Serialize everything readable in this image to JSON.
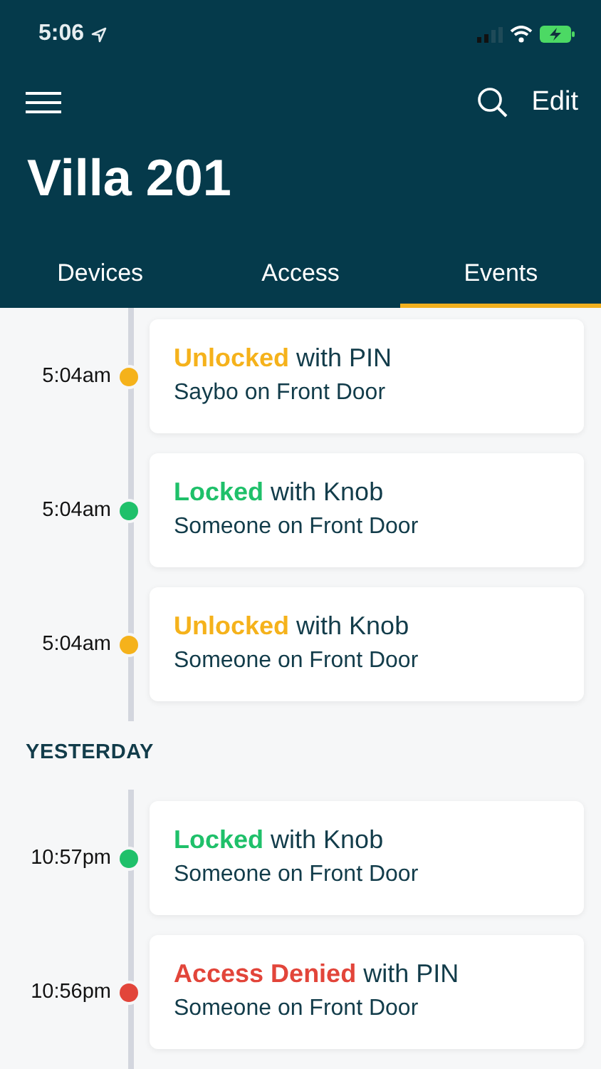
{
  "status_bar": {
    "time": "5:06"
  },
  "header": {
    "title": "Villa 201",
    "action": "Edit"
  },
  "tabs": [
    {
      "label": "Devices",
      "selected": false
    },
    {
      "label": "Access",
      "selected": false
    },
    {
      "label": "Events",
      "selected": true
    }
  ],
  "sections": [
    {
      "events": [
        {
          "time": "5:04am",
          "action": "Unlocked",
          "method": "with PIN",
          "detail": "Saybo on Front Door",
          "color": "#f5b21b"
        },
        {
          "time": "5:04am",
          "action": "Locked",
          "method": "with Knob",
          "detail": "Someone on Front Door",
          "color": "#1fc06a"
        },
        {
          "time": "5:04am",
          "action": "Unlocked",
          "method": "with Knob",
          "detail": "Someone on Front Door",
          "color": "#f5b21b"
        }
      ]
    },
    {
      "heading": "YESTERDAY",
      "events": [
        {
          "time": "10:57pm",
          "action": "Locked",
          "method": "with Knob",
          "detail": "Someone on Front Door",
          "color": "#1fc06a"
        },
        {
          "time": "10:56pm",
          "action": "Access Denied",
          "method": "with PIN",
          "detail": "Someone on Front Door",
          "color": "#e2453a"
        }
      ]
    }
  ]
}
